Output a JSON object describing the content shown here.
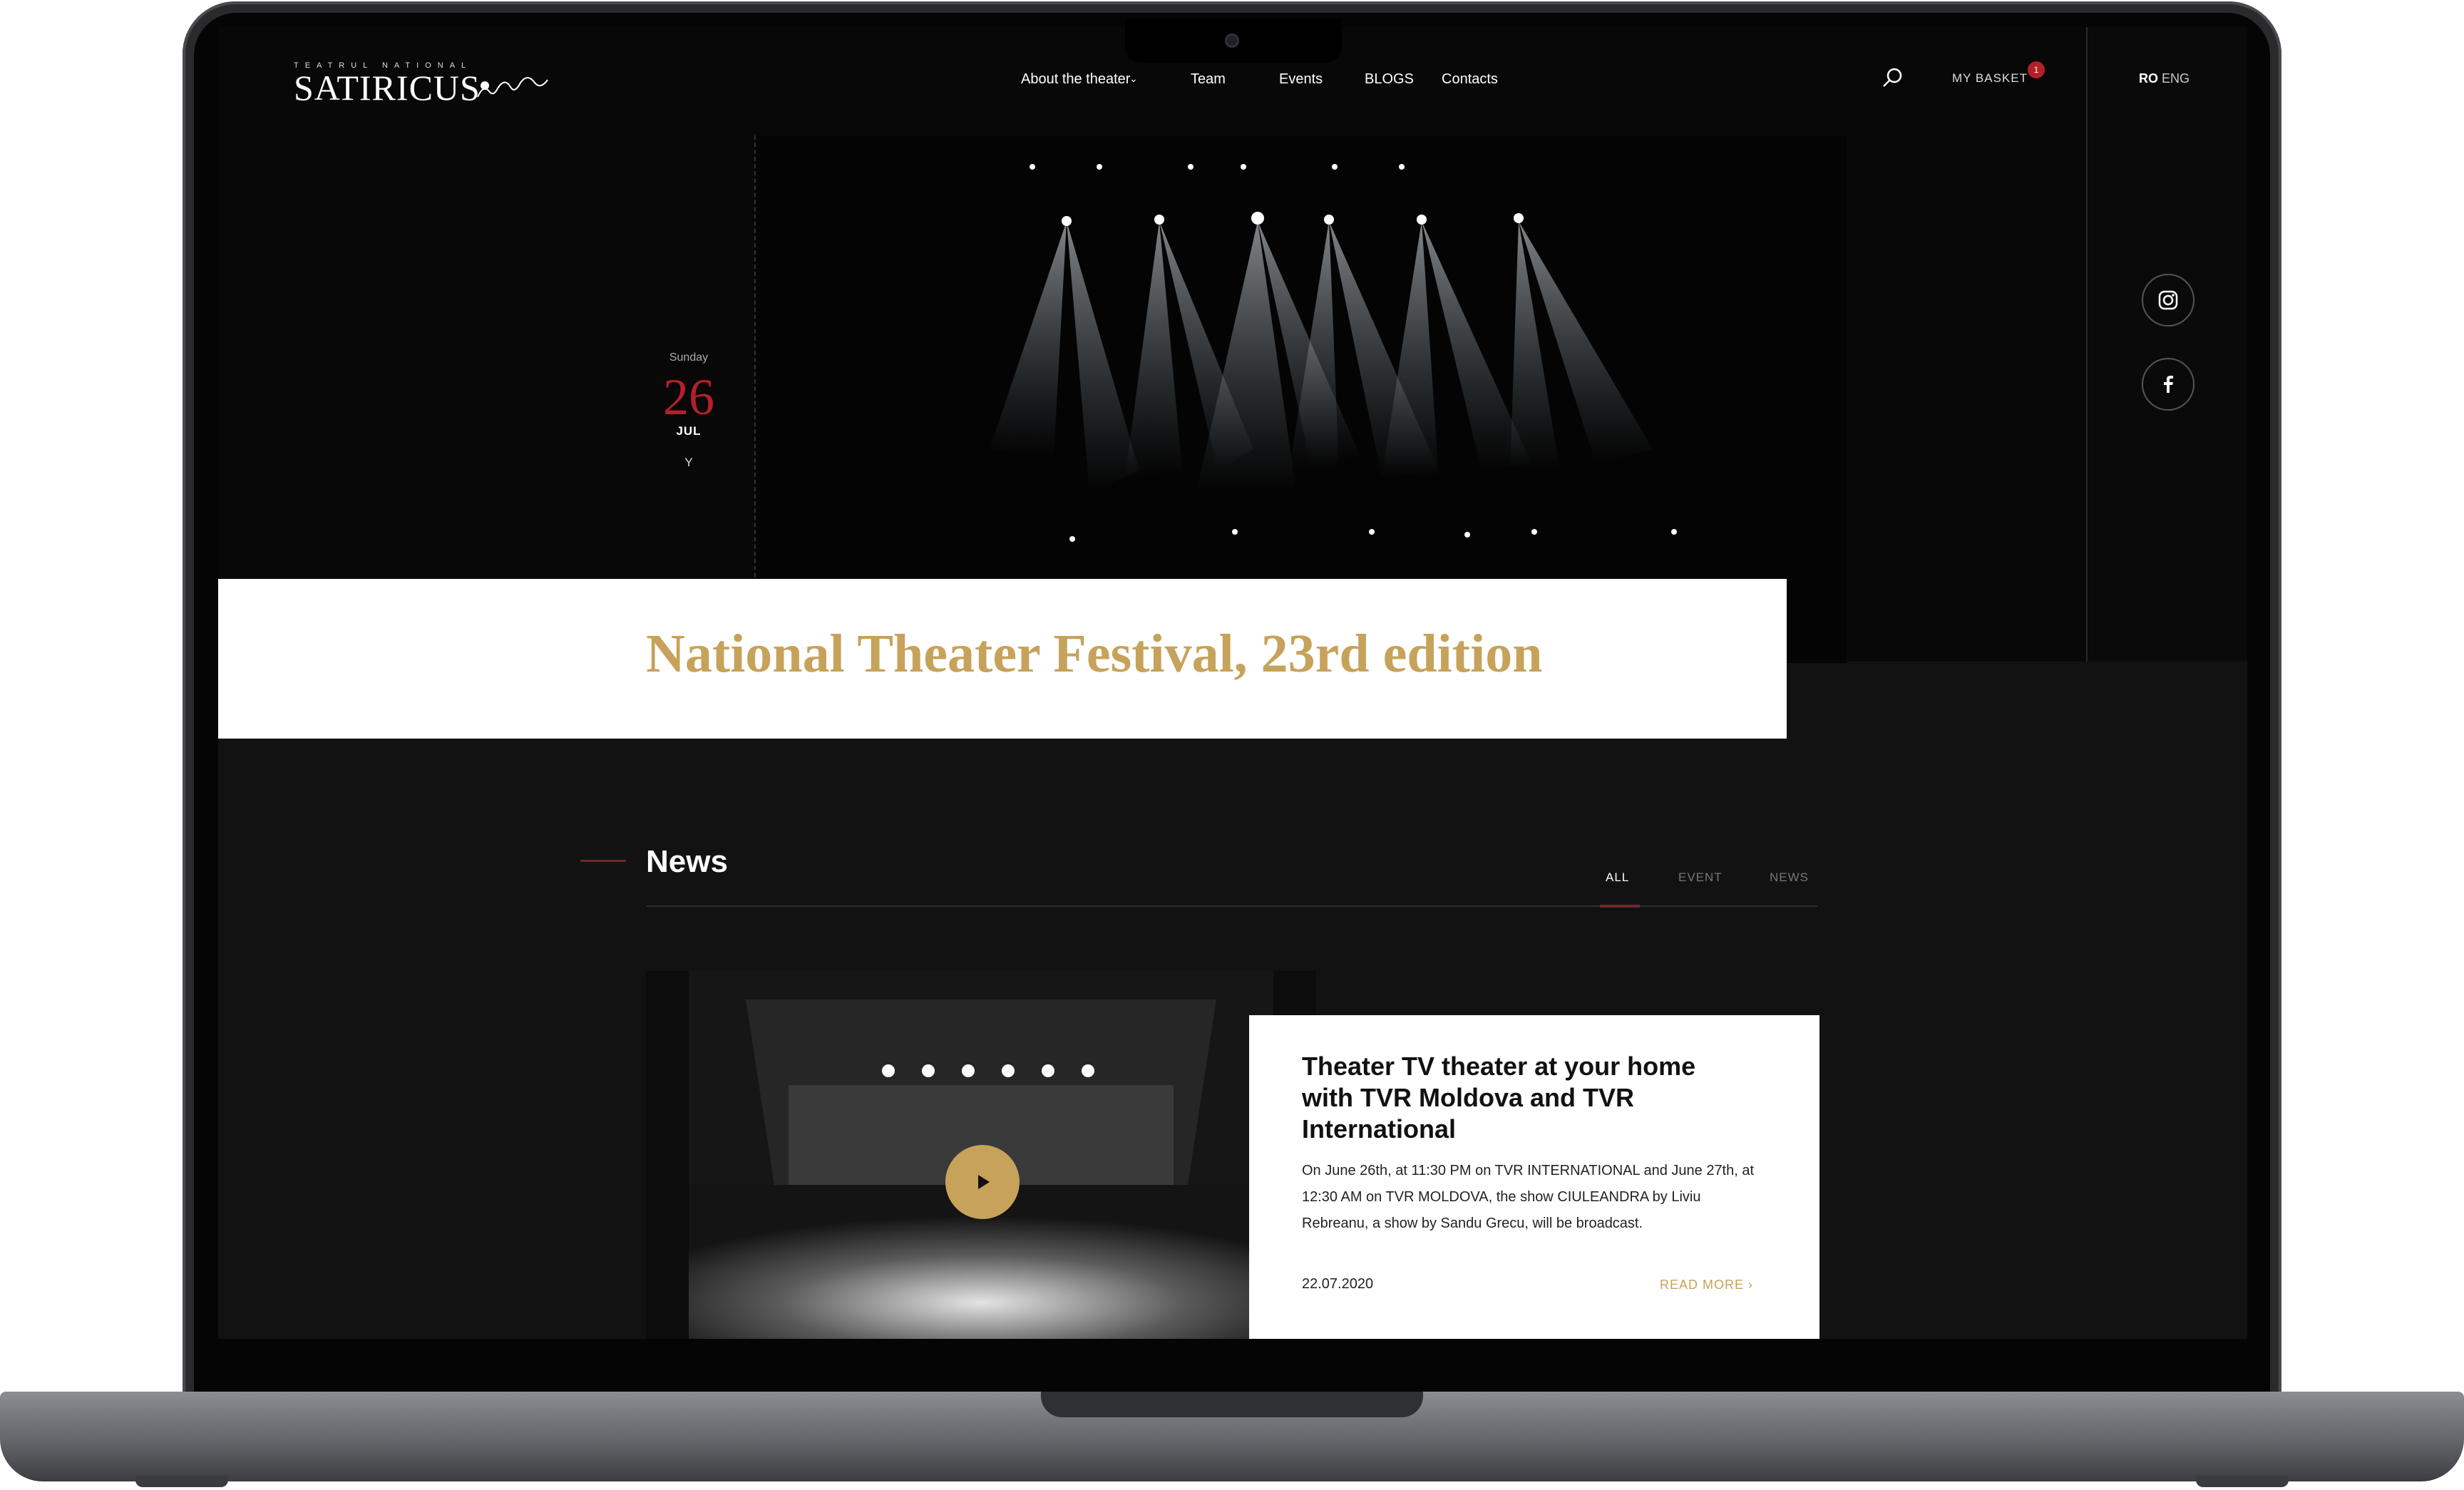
{
  "header": {
    "logo_small": "TEATRUL NATIONAL",
    "logo_big": "SATIRICUS",
    "nav": [
      "About the theater",
      "Team",
      "Events",
      "BLOGS",
      "Contacts"
    ],
    "basket_label": "MY BASKET",
    "basket_count": "1",
    "lang_active": "RO",
    "lang_other": "ENG"
  },
  "hero": {
    "weekday": "Sunday",
    "day": "26",
    "month": "JUL",
    "y": "Y",
    "title": "National Theater Festival, 23rd edition"
  },
  "social": [
    "instagram-icon",
    "facebook-icon"
  ],
  "news": {
    "heading": "News",
    "filters": [
      "ALL",
      "EVENT",
      "NEWS"
    ],
    "active_filter": "ALL",
    "card": {
      "title": "Theater TV theater at your home with TVR Moldova and TVR International",
      "body": "On June 26th, at 11:30 PM on TVR INTERNATIONAL and June 27th, at 12:30 AM on TVR MOLDOVA, the show CIULEANDRA by Liviu Rebreanu, a show by Sandu Grecu, will be broadcast.",
      "date": "22.07.2020",
      "read_more": "READ MORE"
    }
  },
  "colors": {
    "gold": "#c7a25a",
    "red": "#b3202a",
    "dark": "#121212"
  }
}
